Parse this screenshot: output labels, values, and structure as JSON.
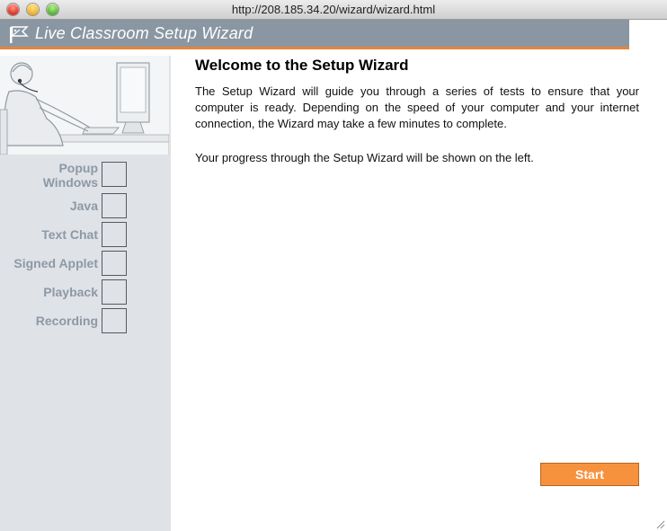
{
  "window": {
    "url": "http://208.185.34.20/wizard/wizard.html"
  },
  "header": {
    "title": "Live Classroom Setup Wizard",
    "accent_color": "#e8843a",
    "bar_color": "#8a97a3"
  },
  "sidebar": {
    "steps": [
      {
        "label": "Popup Windows"
      },
      {
        "label": "Java"
      },
      {
        "label": "Text Chat"
      },
      {
        "label": "Signed Applet"
      },
      {
        "label": "Playback"
      },
      {
        "label": "Recording"
      }
    ]
  },
  "main": {
    "title": "Welcome to the Setup Wizard",
    "intro": "The Setup Wizard will guide you through a series of tests to ensure that your computer is ready. Depending on the speed of your computer and your internet connection, the Wizard may take a few minutes to complete.",
    "progress_note": "Your progress through the Setup Wizard will be shown on the left.",
    "start_label": "Start",
    "start_color": "#f6923e"
  }
}
